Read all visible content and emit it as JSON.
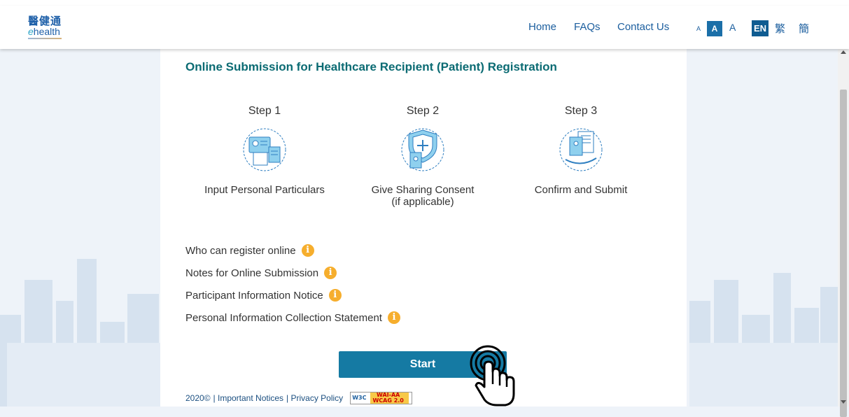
{
  "header": {
    "logo_cn": "醫健通",
    "logo_en_prefix": "e",
    "logo_en_rest": "health",
    "nav": [
      "Home",
      "FAQs",
      "Contact Us"
    ],
    "font_size": {
      "small": "A",
      "medium": "A",
      "large": "A"
    },
    "lang": {
      "en": "EN",
      "tc": "繁",
      "sc": "簡"
    }
  },
  "main": {
    "title": "Online Submission for Healthcare Recipient (Patient) Registration",
    "steps": [
      {
        "label": "Step 1",
        "desc_line1": "Input Personal Particulars",
        "desc_line2": ""
      },
      {
        "label": "Step 2",
        "desc_line1": "Give Sharing Consent",
        "desc_line2": "(if applicable)"
      },
      {
        "label": "Step 3",
        "desc_line1": "Confirm and Submit",
        "desc_line2": ""
      }
    ],
    "info_links": [
      "Who can register online",
      "Notes for Online Submission",
      "Participant Information Notice",
      "Personal Information Collection Statement"
    ],
    "info_icon_glyph": "i",
    "start_label": "Start"
  },
  "footer": {
    "copyright": "2020©",
    "links": [
      "| Important Notices",
      "| Privacy Policy"
    ],
    "badge_w3c": "W3C",
    "badge_wai": "WAI-AA",
    "badge_wcag": "WCAG 2.0"
  },
  "colors": {
    "accent": "#157aa3",
    "title": "#0b6b73",
    "info": "#f6ae2d",
    "nav": "#1b5e9e"
  }
}
